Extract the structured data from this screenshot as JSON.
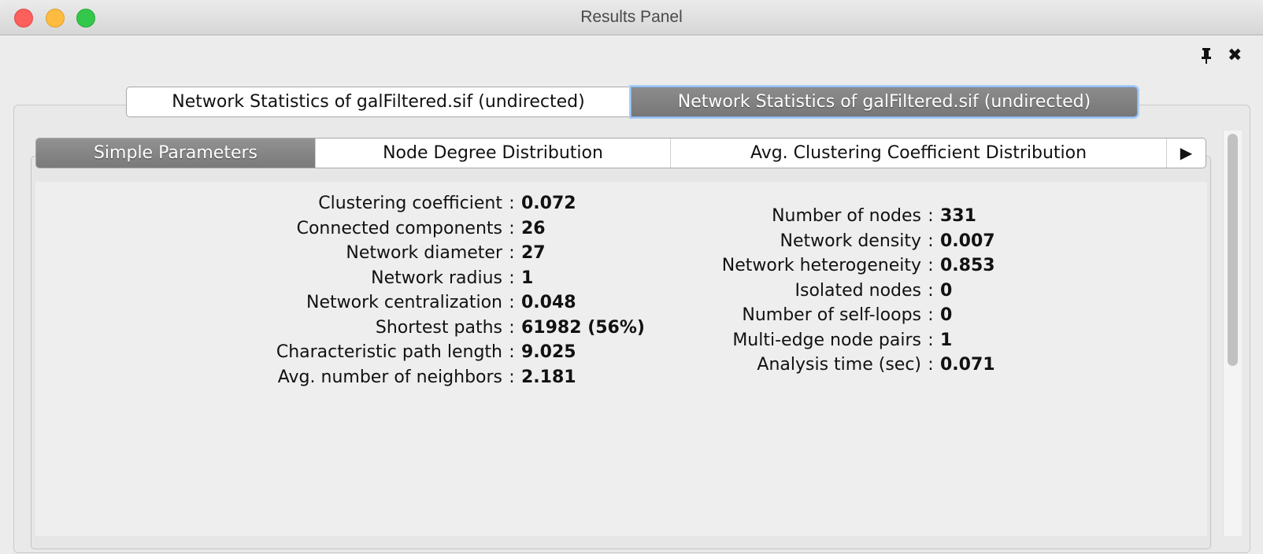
{
  "window": {
    "title": "Results Panel",
    "traffic_lights": {
      "close": "#fc605c",
      "minimize": "#fdbc40",
      "zoom": "#34c84a"
    },
    "pin_icon": "pin-icon",
    "close_icon": "close-icon"
  },
  "outer_tabs": [
    {
      "label": "Network Statistics of galFiltered.sif (undirected)",
      "selected": false
    },
    {
      "label": "Network Statistics of galFiltered.sif (undirected)",
      "selected": true
    }
  ],
  "inner_tabs": [
    {
      "label": "Simple Parameters",
      "selected": true
    },
    {
      "label": "Node Degree Distribution",
      "selected": false
    },
    {
      "label": "Avg. Clustering Coefficient Distribution",
      "selected": false
    }
  ],
  "more_tabs_icon": "▶",
  "separator": ":",
  "left_stats": [
    {
      "label": "Clustering coefficient",
      "value": "0.072"
    },
    {
      "label": "Connected components",
      "value": "26"
    },
    {
      "label": "Network diameter",
      "value": "27"
    },
    {
      "label": "Network radius",
      "value": "1"
    },
    {
      "label": "Network centralization",
      "value": "0.048"
    },
    {
      "label": "Shortest paths",
      "value": "61982 (56%)"
    },
    {
      "label": "Characteristic path length",
      "value": "9.025"
    },
    {
      "label": "Avg. number of neighbors",
      "value": "2.181"
    }
  ],
  "right_stats": [
    {
      "label": "Number of nodes",
      "value": "331"
    },
    {
      "label": "Network density",
      "value": "0.007"
    },
    {
      "label": "Network heterogeneity",
      "value": "0.853"
    },
    {
      "label": "Isolated nodes",
      "value": "0"
    },
    {
      "label": "Number of self-loops",
      "value": "0"
    },
    {
      "label": "Multi-edge node pairs",
      "value": "1"
    },
    {
      "label": "Analysis time (sec)",
      "value": "0.071"
    }
  ]
}
